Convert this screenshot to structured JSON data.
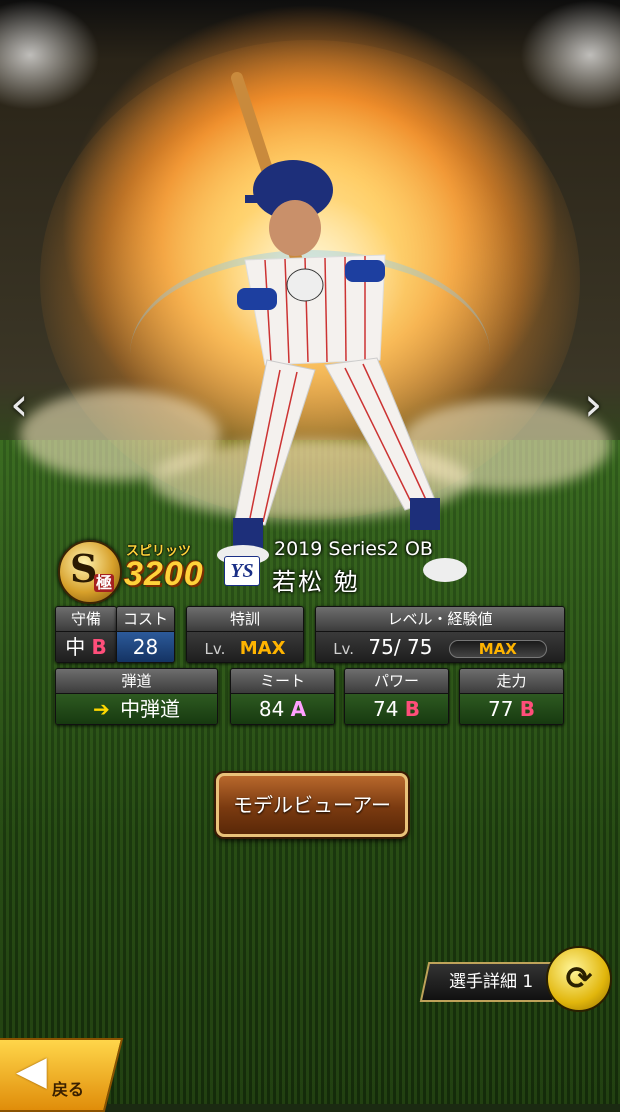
{
  "player": {
    "spirit_label": "スピリッツ",
    "spirit_value": "3200",
    "rank_letter": "S",
    "rank_kanji": "極",
    "team_logo_text": "YS",
    "series": "2019 Series2 OB",
    "name": "若松 勉"
  },
  "stats": {
    "defense": {
      "header": "守備",
      "position": "中",
      "grade": "B"
    },
    "cost": {
      "header": "コスト",
      "value": "28"
    },
    "special_training": {
      "header": "特訓",
      "lv_label": "Lv.",
      "value": "MAX"
    },
    "level": {
      "header": "レベル・経験値",
      "lv_label": "Lv.",
      "current": "75",
      "separator": "/",
      "max": "75",
      "gauge_text": "MAX",
      "progress": 1.0
    },
    "trajectory": {
      "header": "弾道",
      "value": "中弾道"
    },
    "meet": {
      "header": "ミート",
      "value": "84",
      "grade": "A"
    },
    "power": {
      "header": "パワー",
      "value": "74",
      "grade": "B"
    },
    "speed": {
      "header": "走力",
      "value": "77",
      "grade": "B"
    }
  },
  "buttons": {
    "model_viewer": "モデルビューアー",
    "player_detail": "選手詳細 1",
    "back": "戻る"
  },
  "nav": {
    "prev": "‹",
    "next": "›"
  },
  "icons": {
    "switch": "refresh-icon",
    "trajectory": "arrow-up-right-icon",
    "back": "arrow-left-icon"
  },
  "colors": {
    "grade_b": "#ff4e7a",
    "grade_a": "#ffa0ff",
    "max": "#ffb400",
    "spirit": "#ffd23a"
  }
}
